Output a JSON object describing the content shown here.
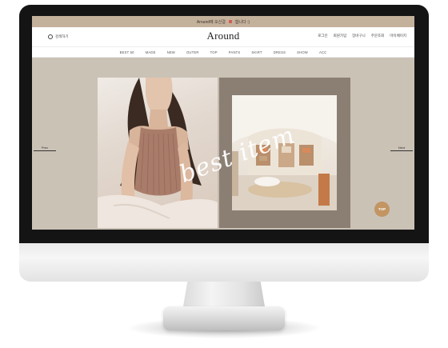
{
  "topbar": {
    "text": "Around에 오신걸",
    "text2": "합니다 :)"
  },
  "header": {
    "search_label": "검색하기",
    "logo": "Around",
    "util_links": [
      "로그인",
      "회원가입",
      "장바구니",
      "주문조회",
      "마이페이지"
    ]
  },
  "nav": {
    "items": [
      "BEST 50",
      "MADE",
      "NEW",
      "OUTER",
      "TOP",
      "PANTS",
      "SKIRT",
      "DRESS",
      "SHOW",
      "ACC"
    ]
  },
  "banner": {
    "script_text": "best item",
    "prev_label": "Prev",
    "next_label": "Next"
  },
  "top_button": {
    "label": "TOP"
  },
  "colors": {
    "accent": "#c29563",
    "background": "#cbc2b6",
    "panel": "#8b7f74",
    "topbar": "#c4b19c"
  }
}
